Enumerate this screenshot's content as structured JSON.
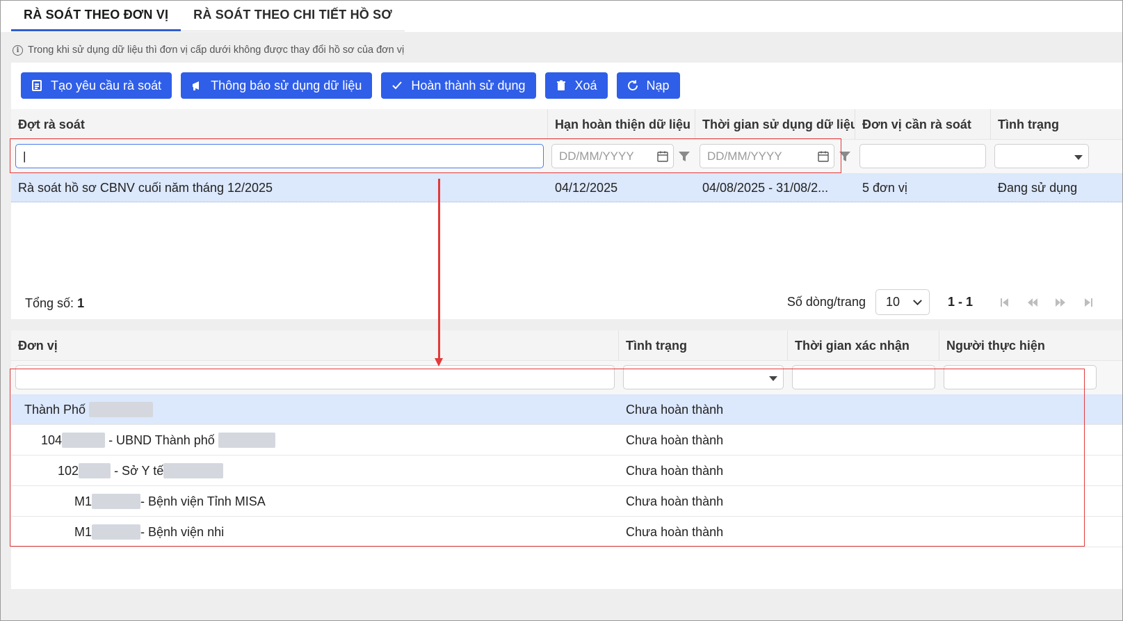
{
  "tabs": [
    {
      "label": "RÀ SOÁT THEO ĐƠN VỊ",
      "active": true
    },
    {
      "label": "RÀ SOÁT THEO CHI TIẾT HỒ SƠ",
      "active": false
    }
  ],
  "info_text": "Trong khi sử dụng dữ liệu thì đơn vị cấp dưới không được thay đổi hồ sơ của đơn vị",
  "toolbar": {
    "create_label": "Tạo yêu cầu rà soát",
    "notify_label": "Thông báo sử dụng dữ liệu",
    "complete_label": "Hoàn thành sử dụng",
    "delete_label": "Xoá",
    "reload_label": "Nạp"
  },
  "grid1": {
    "headers": [
      "Đợt rà soát",
      "Hạn hoàn thiện dữ liệu",
      "Thời gian sử dụng dữ liệu",
      "Đơn vị cần rà soát",
      "Tình trạng"
    ],
    "date_placeholder": "DD/MM/YYYY",
    "rows": [
      {
        "name": "Rà soát hồ sơ CBNV cuối năm tháng 12/2025",
        "deadline": "04/12/2025",
        "period": "04/08/2025 - 31/08/2...",
        "units": "5 đơn vị",
        "status": "Đang sử dụng"
      }
    ],
    "total_label": "Tổng số:",
    "total_value": "1",
    "rows_per_page_label": "Số dòng/trang",
    "rows_per_page": "10",
    "range": "1 - 1"
  },
  "grid2": {
    "headers": [
      "Đơn vị",
      "Tình trạng",
      "Thời gian xác nhận",
      "Người thực hiện"
    ],
    "rows": [
      {
        "prefix": "Thành Phố",
        "suffix": "",
        "status": "Chưa hoàn thành"
      },
      {
        "prefix": "104",
        "suffix": "- UBND Thành phố",
        "status": "Chưa hoàn thành"
      },
      {
        "prefix": "102",
        "suffix": "- Sở Y tế",
        "status": "Chưa hoàn thành"
      },
      {
        "prefix": "M1",
        "suffix": "- Bệnh viện Tỉnh MISA",
        "status": "Chưa hoàn thành"
      },
      {
        "prefix": "M1",
        "suffix": "- Bệnh viện nhi",
        "status": "Chưa hoàn thành"
      }
    ]
  },
  "colors": {
    "accent": "#2f5ee8",
    "highlight": "#e23a3a",
    "selected_row": "#dce8fb"
  }
}
